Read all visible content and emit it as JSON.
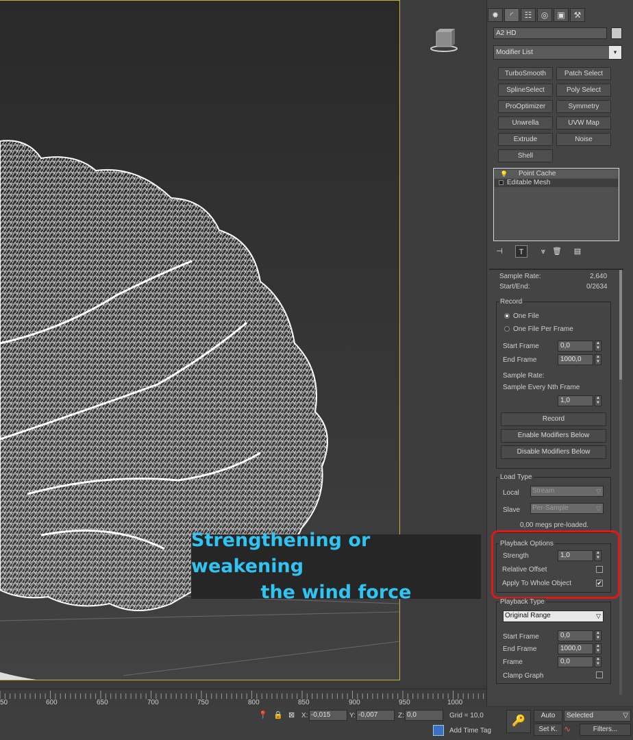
{
  "command_panel": {
    "tabs": [
      "create-icon",
      "modify-icon",
      "hierarchy-icon",
      "motion-icon",
      "display-icon",
      "utilities-icon"
    ],
    "object_name": "A2 HD",
    "modifier_list_label": "Modifier List",
    "modifier_buttons": [
      "TurboSmooth",
      "Patch Select",
      "SplineSelect",
      "Poly Select",
      "ProOptimizer",
      "Symmetry",
      "Unwrella",
      "UVW Map",
      "Extrude",
      "Noise",
      "Shell"
    ],
    "stack": [
      "Point Cache",
      "Editable Mesh"
    ]
  },
  "point_cache": {
    "sample_rate_label": "Sample Rate:",
    "sample_rate_value": "2,640",
    "start_end_label": "Start/End:",
    "start_end_value": "0/2634",
    "record": {
      "title": "Record",
      "one_file": "One File",
      "one_file_per_frame": "One File Per Frame",
      "start_frame_label": "Start Frame",
      "start_frame_value": "0,0",
      "end_frame_label": "End Frame",
      "end_frame_value": "1000,0",
      "sample_rate_label": "Sample Rate:",
      "sample_nth_label": "Sample Every Nth Frame",
      "sample_nth_value": "1,0",
      "record_button": "Record",
      "enable_button": "Enable Modifiers Below",
      "disable_button": "Disable Modifiers Below"
    },
    "load_type": {
      "title": "Load Type",
      "local_label": "Local",
      "local_value": "Stream",
      "slave_label": "Slave",
      "slave_value": "Per-Sample",
      "preloaded": "0,00 megs pre-loaded."
    },
    "playback_options": {
      "title": "Playback Options",
      "strength_label": "Strength",
      "strength_value": "1,0",
      "relative_offset_label": "Relative Offset",
      "apply_whole_label": "Apply To Whole Object"
    },
    "playback_type": {
      "title": "Playback Type",
      "value": "Original Range",
      "start_frame_label": "Start Frame",
      "start_frame_value": "0,0",
      "end_frame_label": "End Frame",
      "end_frame_value": "1000,0",
      "frame_label": "Frame",
      "frame_value": "0,0",
      "clamp_label": "Clamp Graph"
    }
  },
  "caption": {
    "line1": "Strengthening or weakening",
    "line2": "the wind force"
  },
  "timeline": {
    "ticks": [
      "50",
      "600",
      "650",
      "700",
      "750",
      "800",
      "850",
      "900",
      "950",
      "1000"
    ]
  },
  "status": {
    "x_label": "X:",
    "x_value": "-0,015",
    "y_label": "Y:",
    "y_value": "-0,007",
    "z_label": "Z:",
    "z_value": "0,0",
    "grid": "Grid = 10,0",
    "add_time_tag": "Add Time Tag",
    "auto": "Auto",
    "set_key": "Set K.",
    "selected": "Selected",
    "filters": "Filters..."
  },
  "colors": {
    "highlight": "#e01818",
    "caption_text": "#2fc4f2",
    "viewport_border": "#c8b33a"
  }
}
